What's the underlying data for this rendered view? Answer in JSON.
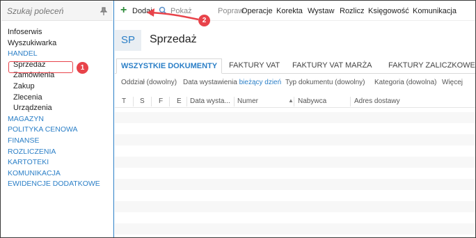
{
  "sidebar": {
    "search_placeholder": "Szukaj poleceń",
    "items": [
      {
        "label": "Infoserwis",
        "type": "item"
      },
      {
        "label": "Wyszukiwarka",
        "type": "item"
      },
      {
        "label": "HANDEL",
        "type": "section"
      },
      {
        "label": "Sprzedaż",
        "type": "sub"
      },
      {
        "label": "Zamówienia",
        "type": "sub"
      },
      {
        "label": "Zakup",
        "type": "sub"
      },
      {
        "label": "Zlecenia",
        "type": "sub"
      },
      {
        "label": "Urządzenia",
        "type": "sub"
      },
      {
        "label": "MAGAZYN",
        "type": "section"
      },
      {
        "label": "POLITYKA CENOWA",
        "type": "section"
      },
      {
        "label": "FINANSE",
        "type": "section"
      },
      {
        "label": "ROZLICZENIA",
        "type": "section"
      },
      {
        "label": "KARTOTEKI",
        "type": "section"
      },
      {
        "label": "KOMUNIKACJA",
        "type": "section"
      },
      {
        "label": "EWIDENCJE DODATKOWE",
        "type": "section"
      }
    ]
  },
  "toolbar": {
    "add": "Dodaj",
    "show": "Pokaż",
    "edit": "Popraw",
    "operations": "Operacje",
    "correction": "Korekta",
    "issue": "Wystaw",
    "settle": "Rozlicz",
    "accounting": "Księgowość",
    "communication": "Komunikacja"
  },
  "callouts": {
    "one": "1",
    "two": "2"
  },
  "header": {
    "badge": "SP",
    "title": "Sprzedaż"
  },
  "tabs": [
    "WSZYSTKIE DOKUMENTY",
    "FAKTURY VAT",
    "FAKTURY VAT MARŻA",
    "FAKTURY ZALICZKOWE"
  ],
  "filters": {
    "branch": "Oddział (dowolny)",
    "date_label": "Data wystawienia",
    "date_value": "bieżący dzień",
    "doc_type": "Typ dokumentu (dowolny)",
    "category": "Kategoria (dowolna)",
    "more": "Więcej"
  },
  "columns": [
    "T",
    "S",
    "F",
    "E",
    "Data wysta...",
    "Numer",
    "Nabywca",
    "Adres dostawy"
  ],
  "colors": {
    "accent": "#2b7fc7",
    "callout": "#e8434a",
    "add": "#2e8b3a"
  }
}
